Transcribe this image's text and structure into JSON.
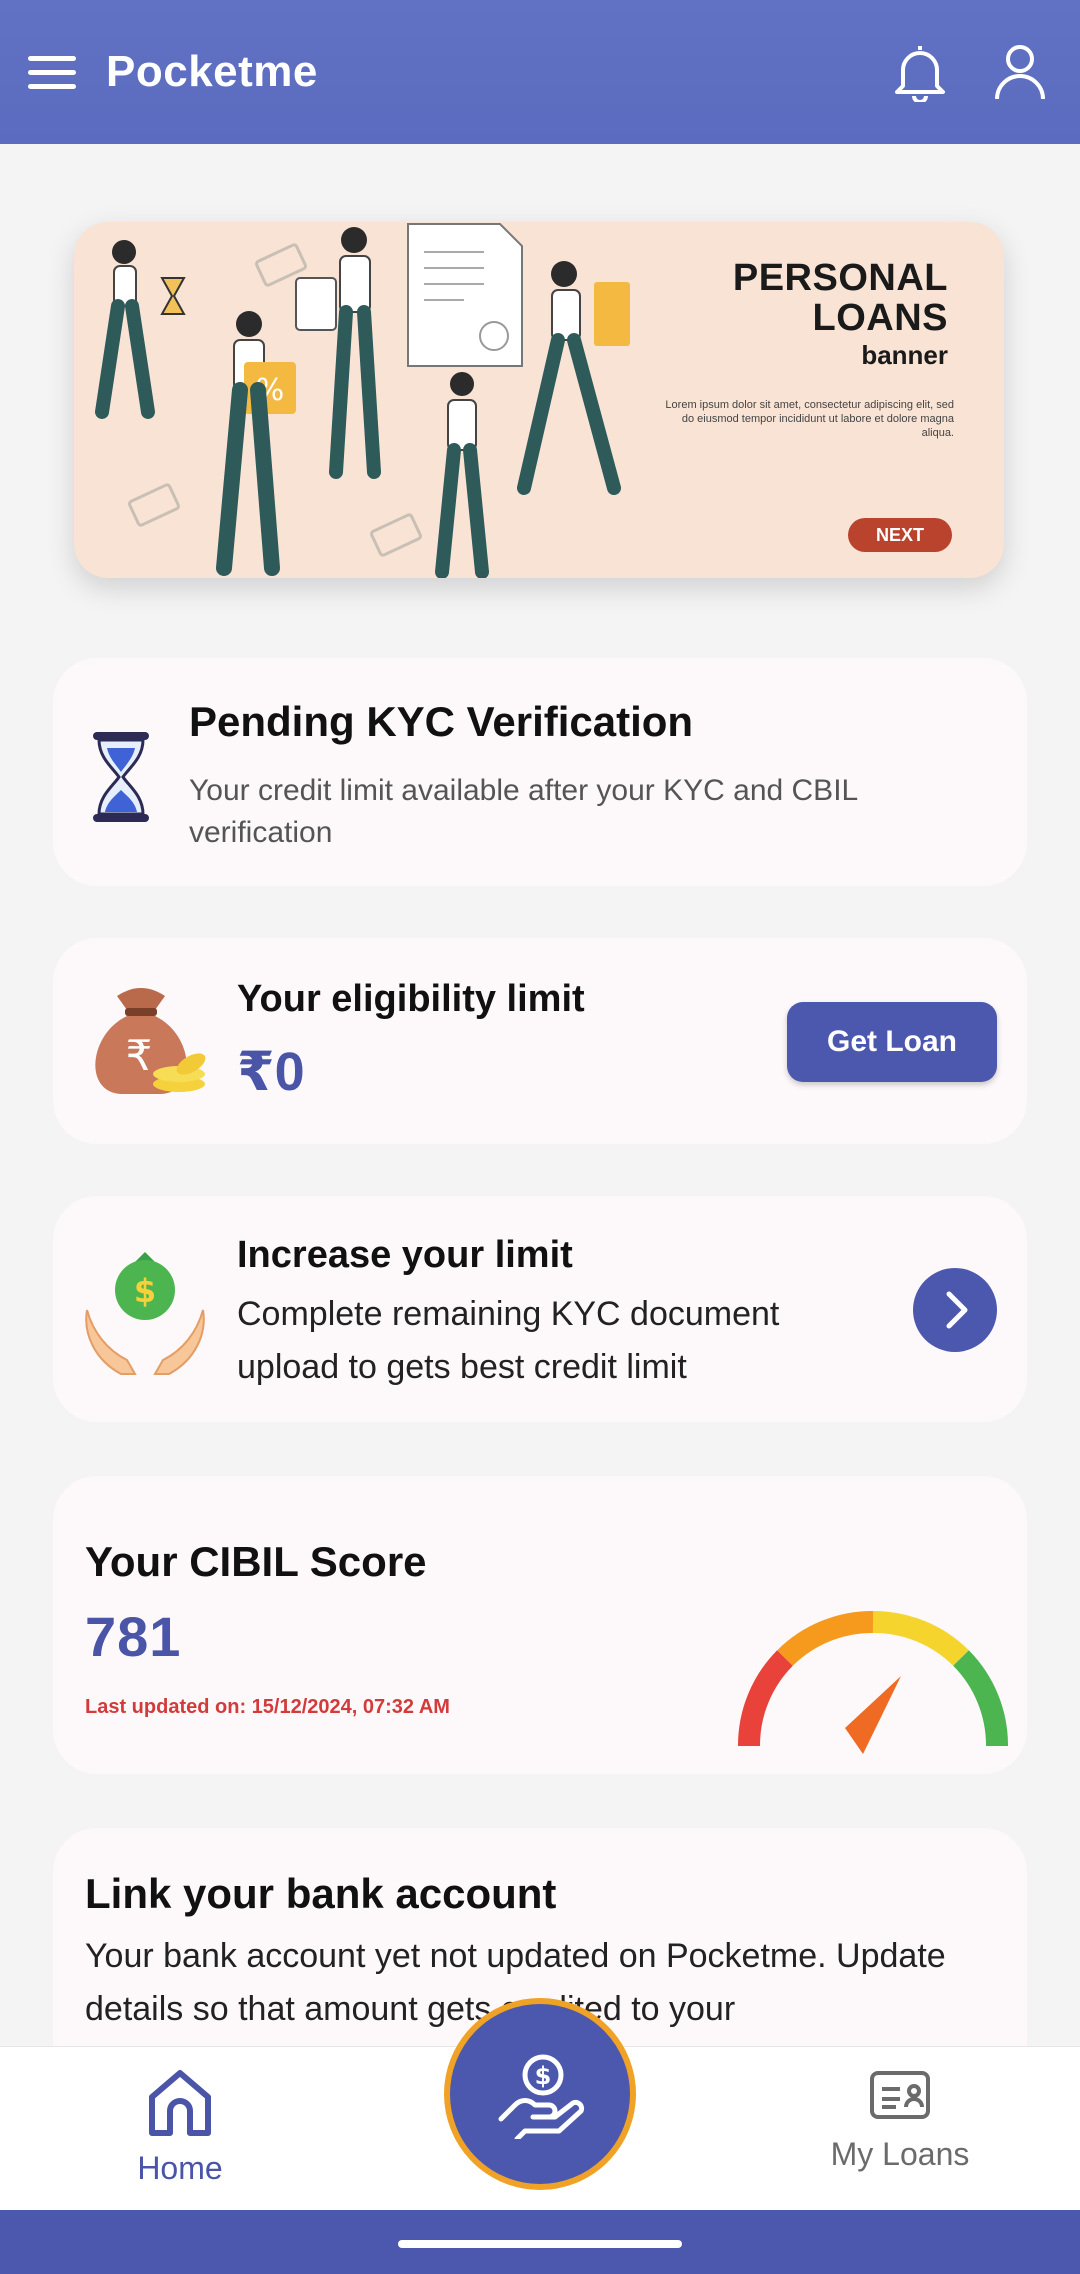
{
  "header": {
    "title": "Pocketme",
    "menu_icon": "hamburger-menu-icon",
    "notification_icon": "bell-icon",
    "profile_icon": "user-icon"
  },
  "banner": {
    "title_line1": "PERSONAL",
    "title_line2": "LOANS",
    "subtitle": "banner",
    "body": "Lorem ipsum dolor sit amet, consectetur adipiscing elit, sed do eiusmod tempor incididunt ut labore et dolore magna aliqua.",
    "next_label": "NEXT"
  },
  "kyc_card": {
    "title": "Pending KYC Verification",
    "description": "Your credit limit available after your KYC and CBIL verification",
    "icon": "hourglass-icon"
  },
  "eligibility_card": {
    "title": "Your eligibility limit",
    "amount": "₹0",
    "button_label": "Get Loan",
    "icon": "money-bag-icon"
  },
  "increase_card": {
    "title": "Increase your limit",
    "description": "Complete remaining KYC document upload to gets best credit limit",
    "icon": "hands-money-icon",
    "arrow_icon": "chevron-right-icon"
  },
  "cibil_card": {
    "title": "Your CIBIL Score",
    "score": "781",
    "updated": "Last updated on: 15/12/2024, 07:32 AM",
    "gauge_icon": "speedometer-gauge-icon"
  },
  "bank_card": {
    "title": "Link your bank account",
    "description": "Your bank account yet not updated on Pocketme. Update details so that amount gets credited to your"
  },
  "bottom_nav": {
    "home_label": "Home",
    "loans_label": "My Loans",
    "fab_icon": "hand-dollar-icon"
  },
  "colors": {
    "primary": "#4b58ad",
    "header": "#5b6bbf",
    "accent_orange": "#f0a226",
    "alert_red": "#d33b3b"
  }
}
